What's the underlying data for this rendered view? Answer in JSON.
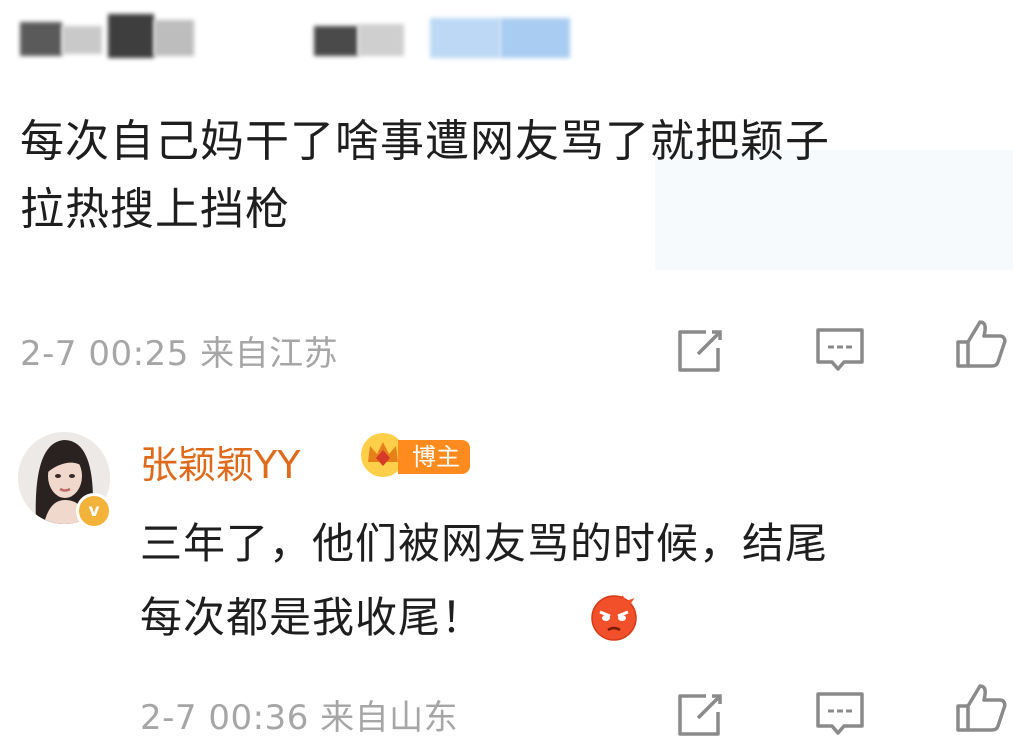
{
  "comment1": {
    "text_line1": "每次自己妈干了啥事遭网友骂了就把颖子",
    "text_line2": "拉热搜上挡枪",
    "timestamp": "2-7 00:25",
    "location": "来自江苏"
  },
  "comment2": {
    "username": "张颖颖YY",
    "badge_label": "博主",
    "verified_mark": "v",
    "text_line1": "三年了，他们被网友骂的时候，结尾",
    "text_line2": "每次都是我收尾！",
    "emoji_icon": "angry-face-icon",
    "timestamp": "2-7 00:36",
    "location": "来自山东"
  },
  "icons": {
    "share": "share-icon",
    "comment": "comment-icon",
    "like": "thumbs-up-icon"
  },
  "colors": {
    "username": "#e06a1c",
    "badge": "#ff8a1e",
    "meta": "#a6a6a6",
    "icon_stroke": "#8a8a8a"
  }
}
